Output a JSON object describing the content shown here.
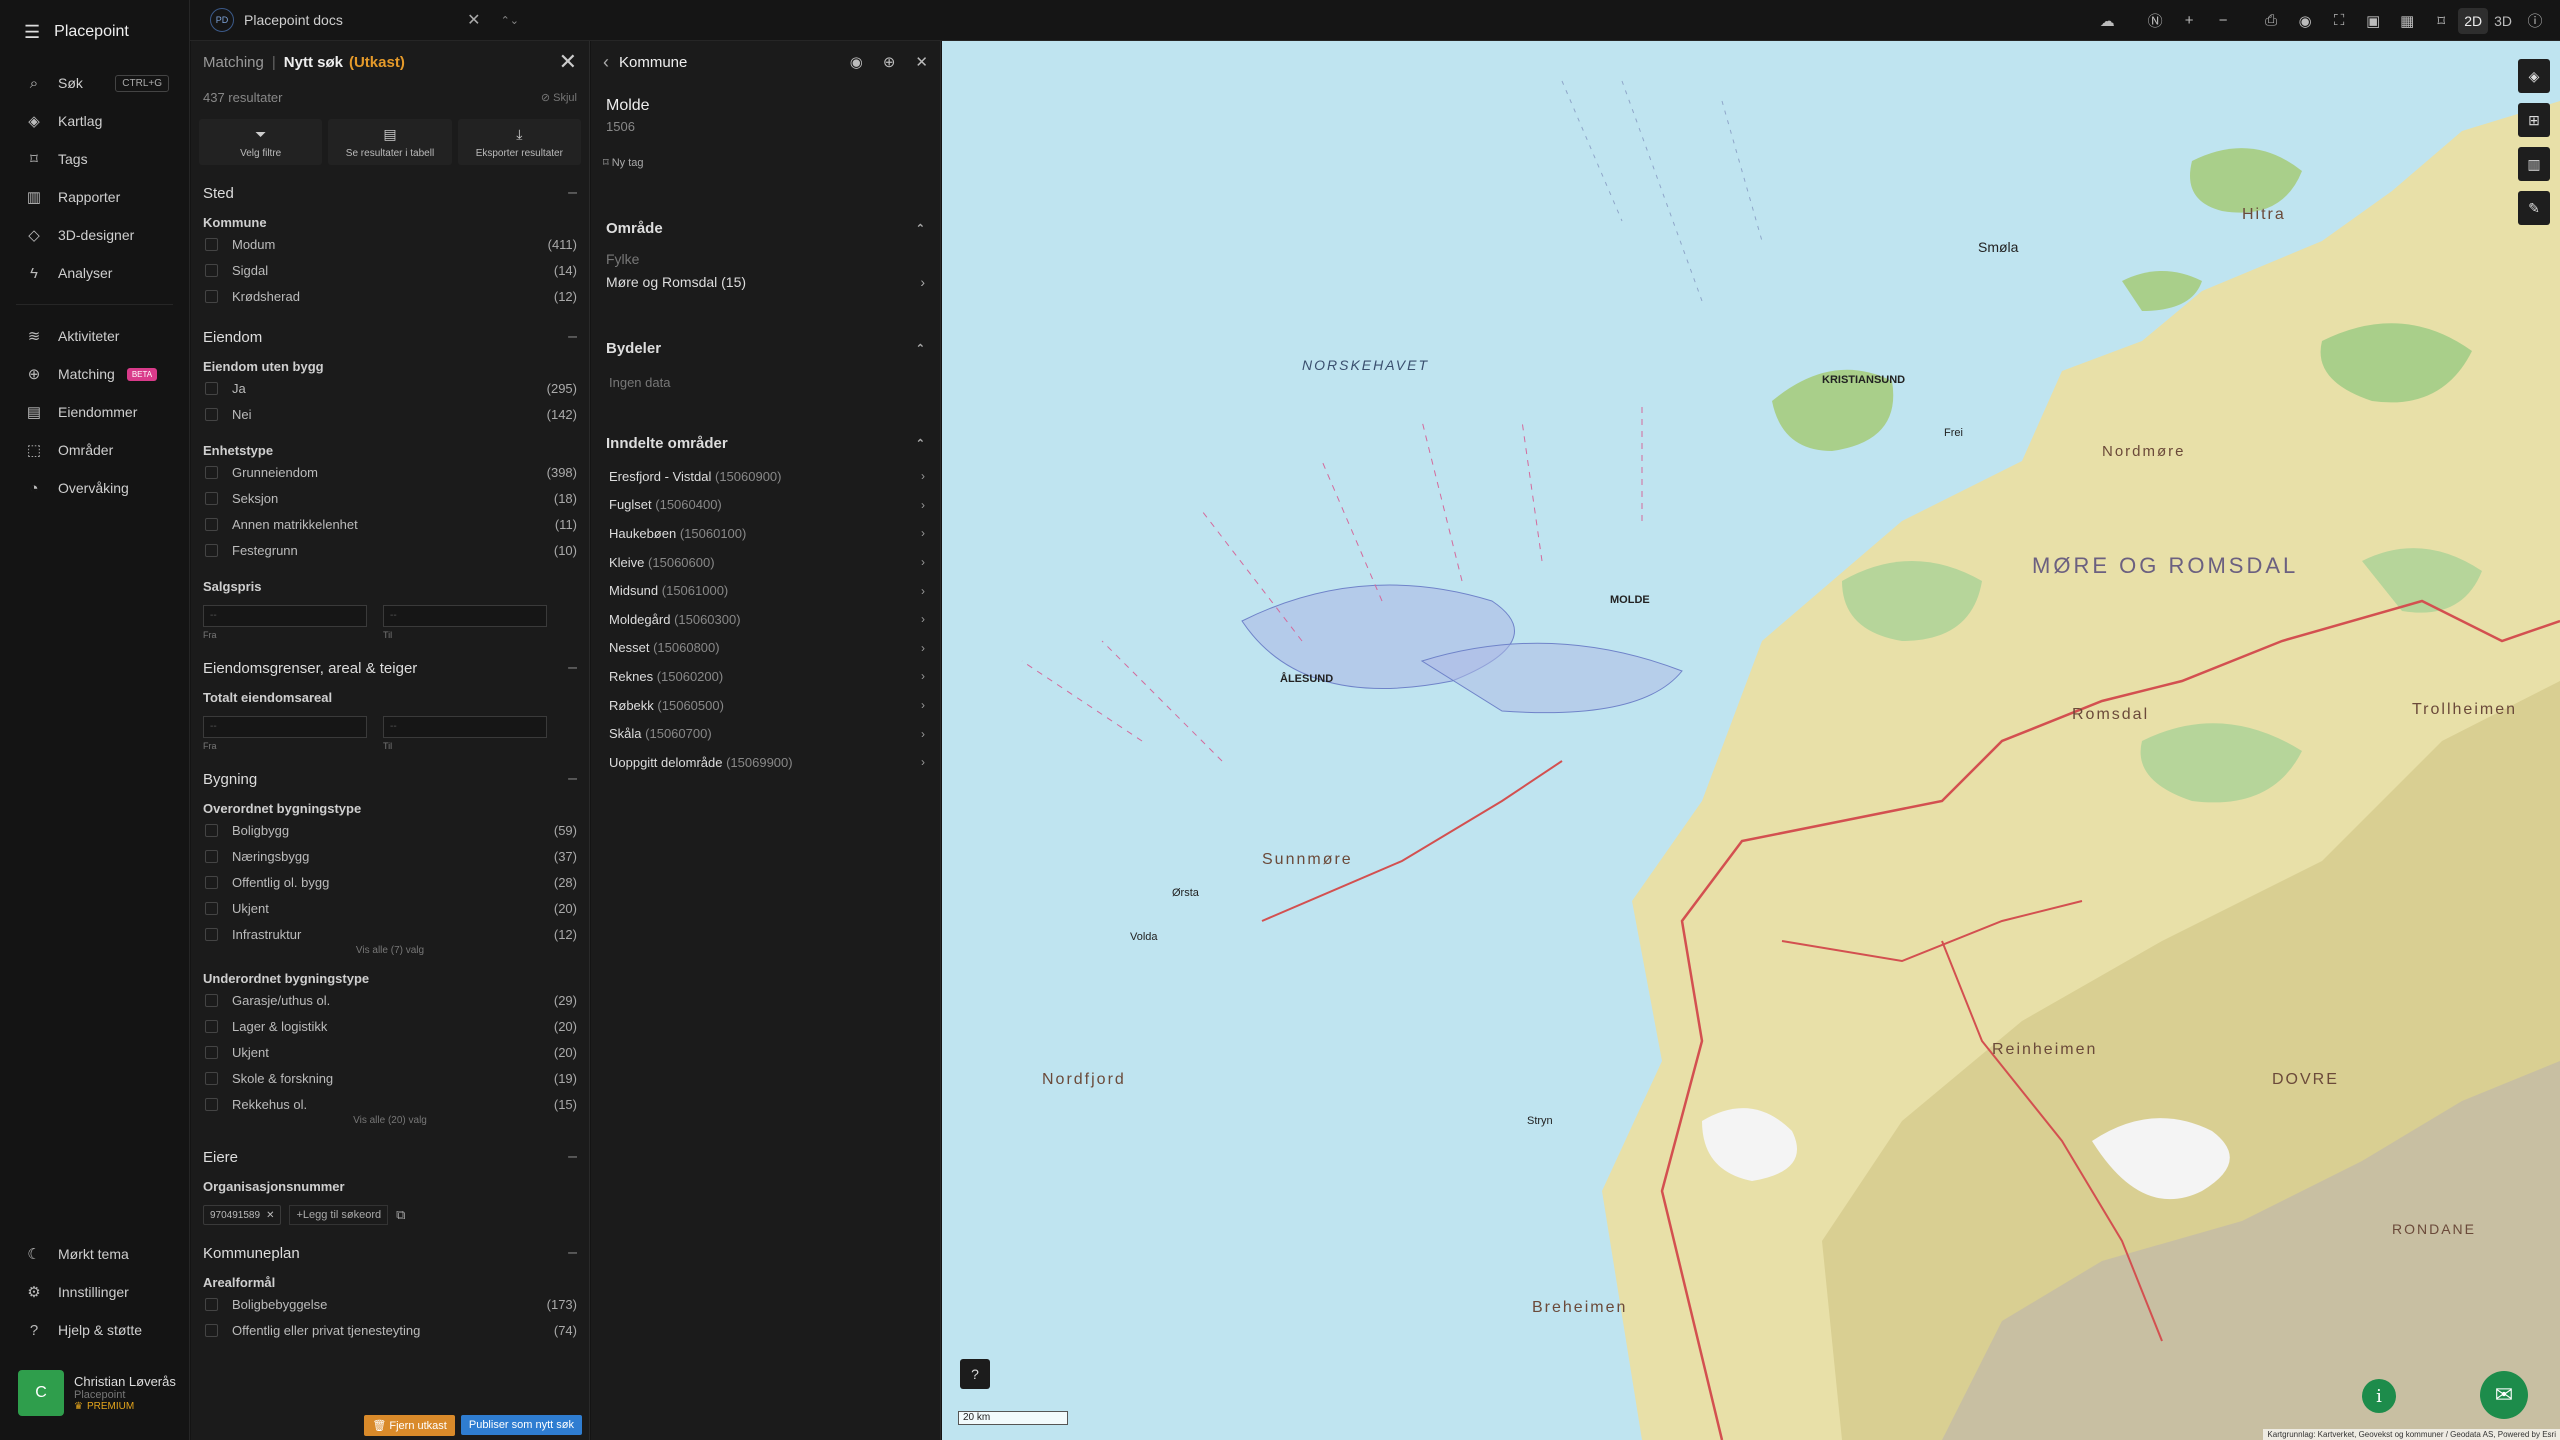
{
  "app": {
    "brand": "Placepoint"
  },
  "topbar": {
    "doc_badge": "PD",
    "doc_title": "Placepoint docs",
    "mode_2d": "2D",
    "mode_3d": "3D"
  },
  "nav": {
    "items": [
      {
        "label": "Søk",
        "shortcut": "CTRL+G",
        "icon": "search-icon"
      },
      {
        "label": "Kartlag",
        "icon": "layers-icon"
      },
      {
        "label": "Tags",
        "icon": "bookmark-icon"
      },
      {
        "label": "Rapporter",
        "icon": "chart-icon"
      },
      {
        "label": "3D-designer",
        "icon": "cube-icon"
      },
      {
        "label": "Analyser",
        "icon": "bolt-icon"
      }
    ],
    "items2": [
      {
        "label": "Aktiviteter",
        "icon": "activity-icon"
      },
      {
        "label": "Matching",
        "badge": "BETA",
        "icon": "target-icon"
      },
      {
        "label": "Eiendommer",
        "icon": "building-icon"
      },
      {
        "label": "Områder",
        "icon": "area-icon"
      },
      {
        "label": "Overvåking",
        "icon": "watch-icon"
      }
    ],
    "bottom": [
      {
        "label": "Mørkt tema",
        "icon": "moon-icon"
      },
      {
        "label": "Innstillinger",
        "icon": "gear-icon"
      },
      {
        "label": "Hjelp & støtte",
        "icon": "help-icon"
      }
    ]
  },
  "user": {
    "initial": "C",
    "name": "Christian Løverås",
    "org": "Placepoint",
    "plan": "PREMIUM"
  },
  "matching": {
    "crumb": "Matching",
    "title": "Nytt søk",
    "draft": "(Utkast)",
    "results": "437 resultater",
    "hide": "Skjul",
    "actions": [
      "Velg filtre",
      "Se resultater i tabell",
      "Eksporter resultater"
    ],
    "sted": {
      "title": "Sted",
      "sub": "Kommune",
      "options": [
        [
          "Modum",
          "(411)"
        ],
        [
          "Sigdal",
          "(14)"
        ],
        [
          "Krødsherad",
          "(12)"
        ]
      ]
    },
    "eiendom": {
      "title": "Eiendom",
      "sub1": "Eiendom uten bygg",
      "opts1": [
        [
          "Ja",
          "(295)"
        ],
        [
          "Nei",
          "(142)"
        ]
      ],
      "sub2": "Enhetstype",
      "opts2": [
        [
          "Grunneiendom",
          "(398)"
        ],
        [
          "Seksjon",
          "(18)"
        ],
        [
          "Annen matrikkelenhet",
          "(11)"
        ],
        [
          "Festegrunn",
          "(10)"
        ]
      ],
      "sub3": "Salgspris",
      "from_ph": "--",
      "to_ph": "--",
      "from": "Fra",
      "to": "Til"
    },
    "grenser": {
      "title": "Eiendomsgrenser, areal & teiger",
      "sub": "Totalt eiendomsareal",
      "from_ph": "--",
      "to_ph": "--",
      "from": "Fra",
      "to": "Til"
    },
    "bygning": {
      "title": "Bygning",
      "sub1": "Overordnet bygningstype",
      "opts1": [
        [
          "Boligbygg",
          "(59)"
        ],
        [
          "Næringsbygg",
          "(37)"
        ],
        [
          "Offentlig ol. bygg",
          "(28)"
        ],
        [
          "Ukjent",
          "(20)"
        ],
        [
          "Infrastruktur",
          "(12)"
        ]
      ],
      "more1": "Vis alle (7) valg",
      "sub2": "Underordnet bygningstype",
      "opts2": [
        [
          "Garasje/uthus ol.",
          "(29)"
        ],
        [
          "Lager & logistikk",
          "(20)"
        ],
        [
          "Ukjent",
          "(20)"
        ],
        [
          "Skole & forskning",
          "(19)"
        ],
        [
          "Rekkehus ol.",
          "(15)"
        ]
      ],
      "more2": "Vis alle (20) valg"
    },
    "eiere": {
      "title": "Eiere",
      "sub": "Organisasjonsnummer",
      "chip": "970491589",
      "add": "Legg til søkeord"
    },
    "kommuneplan": {
      "title": "Kommuneplan",
      "sub": "Arealformål",
      "opts": [
        [
          "Boligbebyggelse",
          "(173)"
        ],
        [
          "Offentlig eller privat tjenesteyting",
          "(74)"
        ]
      ]
    },
    "footer": {
      "remove": "Fjern utkast",
      "publish": "Publiser som nytt søk"
    }
  },
  "kommune": {
    "header": "Kommune",
    "name": "Molde",
    "code": "1506",
    "newtag": "Ny tag",
    "omrade": {
      "title": "Område",
      "label": "Fylke",
      "value": "Møre og Romsdal (15)"
    },
    "bydeler": {
      "title": "Bydeler",
      "empty": "Ingen data"
    },
    "inndelte": {
      "title": "Inndelte områder",
      "items": [
        [
          "Eresfjord - Vistdal",
          "(15060900)"
        ],
        [
          "Fuglset",
          "(15060400)"
        ],
        [
          "Haukebøen",
          "(15060100)"
        ],
        [
          "Kleive",
          "(15060600)"
        ],
        [
          "Midsund",
          "(15061000)"
        ],
        [
          "Moldegård",
          "(15060300)"
        ],
        [
          "Nesset",
          "(15060800)"
        ],
        [
          "Reknes",
          "(15060200)"
        ],
        [
          "Røbekk",
          "(15060500)"
        ],
        [
          "Skåla",
          "(15060700)"
        ],
        [
          "Uoppgitt delområde",
          "(15069900)"
        ]
      ]
    }
  },
  "map": {
    "labels": {
      "sea": "NORSKEHAVET",
      "region": "MØRE OG ROMSDAL",
      "romsdal": "Romsdal",
      "sunnmore": "Sunnmøre",
      "nordfjord": "Nordfjord",
      "reinheimen": "Reinheimen",
      "trollheimen": "Trollheimen",
      "dovre": "DOVRE",
      "rondane": "RONDANE",
      "hitra": "Hitra",
      "breheimen": "Breheimen",
      "nordmore": "Nordmøre"
    },
    "towns": {
      "kristiansund": "KRISTIANSUND",
      "molde": "MOLDE",
      "alesund": "ÅLESUND",
      "smola": "Smøla",
      "orsta": "Ørsta",
      "volda": "Volda",
      "stryn": "Stryn",
      "frei": "Frei"
    },
    "scale": "20 km",
    "attribution": "Kartgrunnlag: Kartverket, Geovekst og kommuner / Geodata AS, Powered by Esri",
    "colors": {
      "sea": "#bfe4f0",
      "land": "#e8e0a8",
      "green": "#a9cf8a",
      "border": "#d35050"
    }
  }
}
